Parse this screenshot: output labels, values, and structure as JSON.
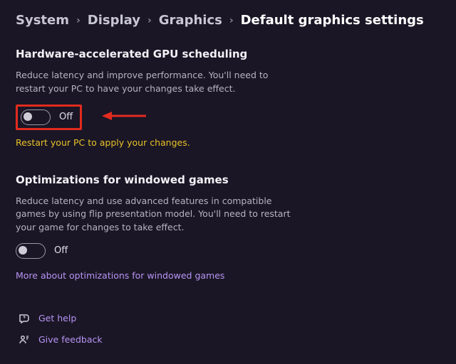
{
  "breadcrumb": {
    "items": [
      "System",
      "Display",
      "Graphics"
    ],
    "current": "Default graphics settings"
  },
  "sections": {
    "gpu": {
      "title": "Hardware-accelerated GPU scheduling",
      "desc": "Reduce latency and improve performance. You'll need to restart your PC to have your changes take effect.",
      "toggle_label": "Off",
      "warning": "Restart your PC to apply your changes."
    },
    "windowed": {
      "title": "Optimizations for windowed games",
      "desc": "Reduce latency and use advanced features in compatible games by using flip presentation model. You'll need to restart your game for changes to take effect.",
      "toggle_label": "Off",
      "link": "More about optimizations for windowed games"
    }
  },
  "footer": {
    "help": "Get help",
    "feedback": "Give feedback"
  },
  "annotation": {
    "arrow_color": "#e22b1f"
  }
}
